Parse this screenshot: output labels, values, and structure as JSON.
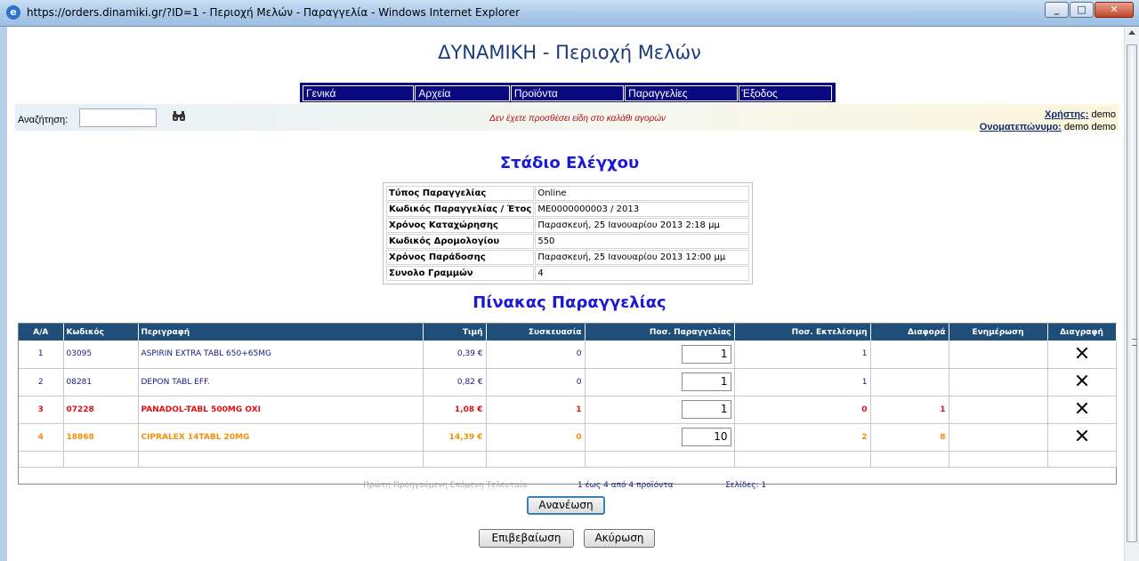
{
  "window": {
    "title": "https://orders.dinamiki.gr/?ID=1 - Περιοχή Μελών - Παραγγελία - Windows Internet Explorer",
    "buttons": [
      "_",
      "□",
      "✕"
    ]
  },
  "site_title": "ΔΥΝΑΜΙΚΗ - Περιοχή Μελών",
  "menu": [
    {
      "label": "Γενικά"
    },
    {
      "label": "Αρχεία"
    },
    {
      "label": "Προϊόντα"
    },
    {
      "label": "Παραγγελίες"
    },
    {
      "label": "Έξοδος"
    }
  ],
  "search": {
    "label": "Αναζήτηση:",
    "value": "",
    "icon": "binoculars-icon"
  },
  "cart_message": "Δεν έχετε προσθέσει είδη στο καλάθι αγορών",
  "user": {
    "user_label": "Χρήστης:",
    "user_value": "demo",
    "name_label": "Ονοματεπώνυμο:",
    "name_value": "demo demo"
  },
  "check_title": "Στάδιο Ελέγχου",
  "details": [
    {
      "key": "Τύπος Παραγγελίας",
      "value": "Online"
    },
    {
      "key": "Κωδικός Παραγγελίας / Έτος",
      "value": "ME0000000003 / 2013"
    },
    {
      "key": "Χρόνος Καταχώρησης",
      "value": "Παρασκευή, 25 Ιανουαρίου 2013 2:18 μμ"
    },
    {
      "key": "Κωδικός Δρομολογίου",
      "value": "550"
    },
    {
      "key": "Χρόνος Παράδοσης",
      "value": "Παρασκευή, 25 Ιανουαρίου 2013 12:00 μμ"
    },
    {
      "key": "Συνολο Γραμμών",
      "value": "4"
    }
  ],
  "orders_title": "Πίνακας Παραγγελίας",
  "orders": {
    "headers": [
      "Α/Α",
      "Κωδικός",
      "Περιγραφή",
      "Τιμή",
      "Συσκευασία",
      "Ποσ. Παραγγελίας",
      "Ποσ. Εκτελέσιμη",
      "Διαφορά",
      "Ενημέρωση",
      "Διαγραφή"
    ],
    "rows": [
      {
        "aa": "1",
        "code": "03095",
        "desc": "ASPIRIN EXTRA TABL 650+65MG",
        "price": "0,39 €",
        "pack": "0",
        "qty": "1",
        "exec": "1",
        "diff": "",
        "update": "",
        "status": "normal"
      },
      {
        "aa": "2",
        "code": "08281",
        "desc": "DEPON TABL EFF.",
        "price": "0,82 €",
        "pack": "0",
        "qty": "1",
        "exec": "1",
        "diff": "",
        "update": "",
        "status": "normal"
      },
      {
        "aa": "3",
        "code": "07228",
        "desc": "PANADOL-TABL 500MG OXI",
        "price": "1,08 €",
        "pack": "1",
        "qty": "1",
        "exec": "0",
        "diff": "1",
        "update": "",
        "status": "red"
      },
      {
        "aa": "4",
        "code": "18868",
        "desc": "CIPRALEX 14TABL 20MG",
        "price": "14,39 €",
        "pack": "0",
        "qty": "10",
        "exec": "2",
        "diff": "8",
        "update": "",
        "status": "orange"
      }
    ],
    "delete_icon": "close-x-icon"
  },
  "pager": {
    "nav": "Πρώτη Προηγούμενη Επόμενη Τελευταία",
    "count": "1 έως 4 από 4 προϊόντα",
    "pages": "Σελίδες: 1"
  },
  "buttons": {
    "refresh": "Ανανέωση",
    "confirm": "Επιβεβαίωση",
    "cancel": "Ακύρωση"
  }
}
